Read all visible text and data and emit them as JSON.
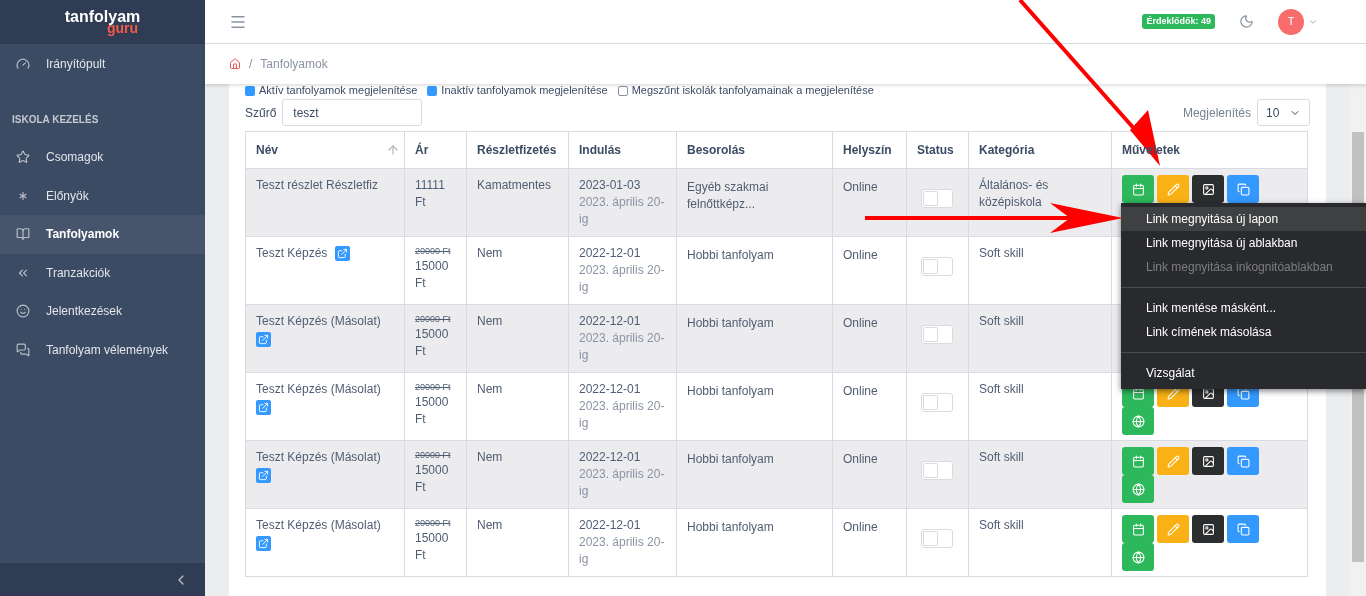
{
  "sidebar": {
    "logo": {
      "main": "tanfolyam",
      "accent": "guru"
    },
    "items": [
      {
        "kind": "link",
        "label": "Irányítópult",
        "selected": false
      },
      {
        "kind": "heading",
        "label": "ISKOLA KEZELÉS"
      },
      {
        "kind": "link",
        "label": "Csomagok",
        "selected": false
      },
      {
        "kind": "link",
        "label": "Előnyök",
        "selected": false
      },
      {
        "kind": "link",
        "label": "Tanfolyamok",
        "selected": true
      },
      {
        "kind": "link",
        "label": "Tranzakciók",
        "selected": false
      },
      {
        "kind": "link",
        "label": "Jelentkezések",
        "selected": false
      },
      {
        "kind": "link",
        "label": "Tanfolyam vélemények",
        "selected": false
      }
    ]
  },
  "header": {
    "badge": "Érdeklődők: 49",
    "avatar": "T"
  },
  "breadcrumb": {
    "separator": "/",
    "items": [
      "Tanfolyamok"
    ]
  },
  "filters": [
    {
      "label": "Aktív tanfolyamok megjelenítése",
      "checked": true
    },
    {
      "label": "Inaktív tanfolyamok megjelenítése",
      "checked": true
    },
    {
      "label": "Megszűnt iskolák tanfolyamainak a megjelenítése",
      "checked": false
    }
  ],
  "search": {
    "label": "Szűrő",
    "value": "teszt"
  },
  "page_size": {
    "label": "Megjelenítés",
    "value": "10"
  },
  "table": {
    "columns": [
      {
        "label": "Név",
        "sorted": true
      },
      {
        "label": "Ár",
        "sorted": false
      },
      {
        "label": "Részletfizetés",
        "sorted": false
      },
      {
        "label": "Indulás",
        "sorted": false
      },
      {
        "label": "Besorolás",
        "sorted": false
      },
      {
        "label": "Helyszín",
        "sorted": false
      },
      {
        "label": "Status",
        "sorted": false
      },
      {
        "label": "Kategória",
        "sorted": false
      },
      {
        "label": "Műveletek",
        "sorted": false
      }
    ],
    "rows": [
      {
        "name": "Teszt részlet Részletfiz",
        "has_link": false,
        "price": "11111 Ft",
        "installment": "Kamatmentes",
        "start": "2023-01-03",
        "until": "2023. április 20-ig",
        "type": "Egyéb szakmai felnőttképz...",
        "location": "Online",
        "on": false,
        "category": "Általános- és középiskola",
        "actions": [
          {
            "kind": "calendar"
          },
          {
            "kind": "edit"
          },
          {
            "kind": "image"
          },
          {
            "kind": "copy"
          }
        ]
      },
      {
        "name": "Teszt Képzés",
        "has_link": true,
        "old_price": "20000 Ft",
        "price": "15000 Ft",
        "installment": "Nem",
        "start": "2022-12-01",
        "until": "2023. április 20-ig",
        "type": "Hobbi tanfolyam",
        "location": "Online",
        "on": false,
        "category": "Soft skill"
      },
      {
        "name": "Teszt Képzés (Másolat)",
        "has_link": true,
        "old_price": "20000 Ft",
        "price": "15000 Ft",
        "installment": "Nem",
        "start": "2022-12-01",
        "until": "2023. április 20-ig",
        "type": "Hobbi tanfolyam",
        "location": "Online",
        "on": false,
        "category": "Soft skill"
      },
      {
        "name": "Teszt Képzés (Másolat)",
        "has_link": true,
        "old_price": "20000 Ft",
        "price": "15000 Ft",
        "installment": "Nem",
        "start": "2022-12-01",
        "until": "2023. április 20-ig",
        "type": "Hobbi tanfolyam",
        "location": "Online",
        "on": false,
        "category": "Soft skill",
        "actions": [
          {
            "kind": "calendar"
          },
          {
            "kind": "edit"
          },
          {
            "kind": "image"
          },
          {
            "kind": "copy"
          },
          {
            "kind": "globe"
          }
        ]
      },
      {
        "name": "Teszt Képzés (Másolat)",
        "has_link": true,
        "old_price": "20000 Ft",
        "price": "15000 Ft",
        "installment": "Nem",
        "start": "2022-12-01",
        "until": "2023. április 20-ig",
        "type": "Hobbi tanfolyam",
        "location": "Online",
        "on": false,
        "category": "Soft skill",
        "actions": [
          {
            "kind": "calendar"
          },
          {
            "kind": "edit"
          },
          {
            "kind": "image"
          },
          {
            "kind": "copy"
          },
          {
            "kind": "globe"
          }
        ]
      },
      {
        "name": "Teszt Képzés (Másolat)",
        "has_link": true,
        "old_price": "20000 Ft",
        "price": "15000 Ft",
        "installment": "Nem",
        "start": "2022-12-01",
        "until": "2023. április 20-ig",
        "type": "Hobbi tanfolyam",
        "location": "Online",
        "on": false,
        "category": "Soft skill",
        "actions": [
          {
            "kind": "calendar"
          },
          {
            "kind": "edit"
          },
          {
            "kind": "image"
          },
          {
            "kind": "copy"
          },
          {
            "kind": "globe"
          }
        ]
      }
    ]
  },
  "context_menu": [
    {
      "kind": "item",
      "label": "Link megnyitása új lapon",
      "selected": true,
      "disabled": false
    },
    {
      "kind": "item",
      "label": "Link megnyitása új ablakban",
      "selected": false,
      "disabled": false
    },
    {
      "kind": "item",
      "label": "Link megnyitása inkognitóablakban",
      "selected": false,
      "disabled": true
    },
    {
      "kind": "separator"
    },
    {
      "kind": "item",
      "label": "Link mentése másként...",
      "selected": false,
      "disabled": false
    },
    {
      "kind": "item",
      "label": "Link címének másolása",
      "selected": false,
      "disabled": false
    },
    {
      "kind": "separator"
    },
    {
      "kind": "item",
      "label": "Vizsgálat",
      "selected": false,
      "disabled": false
    }
  ]
}
